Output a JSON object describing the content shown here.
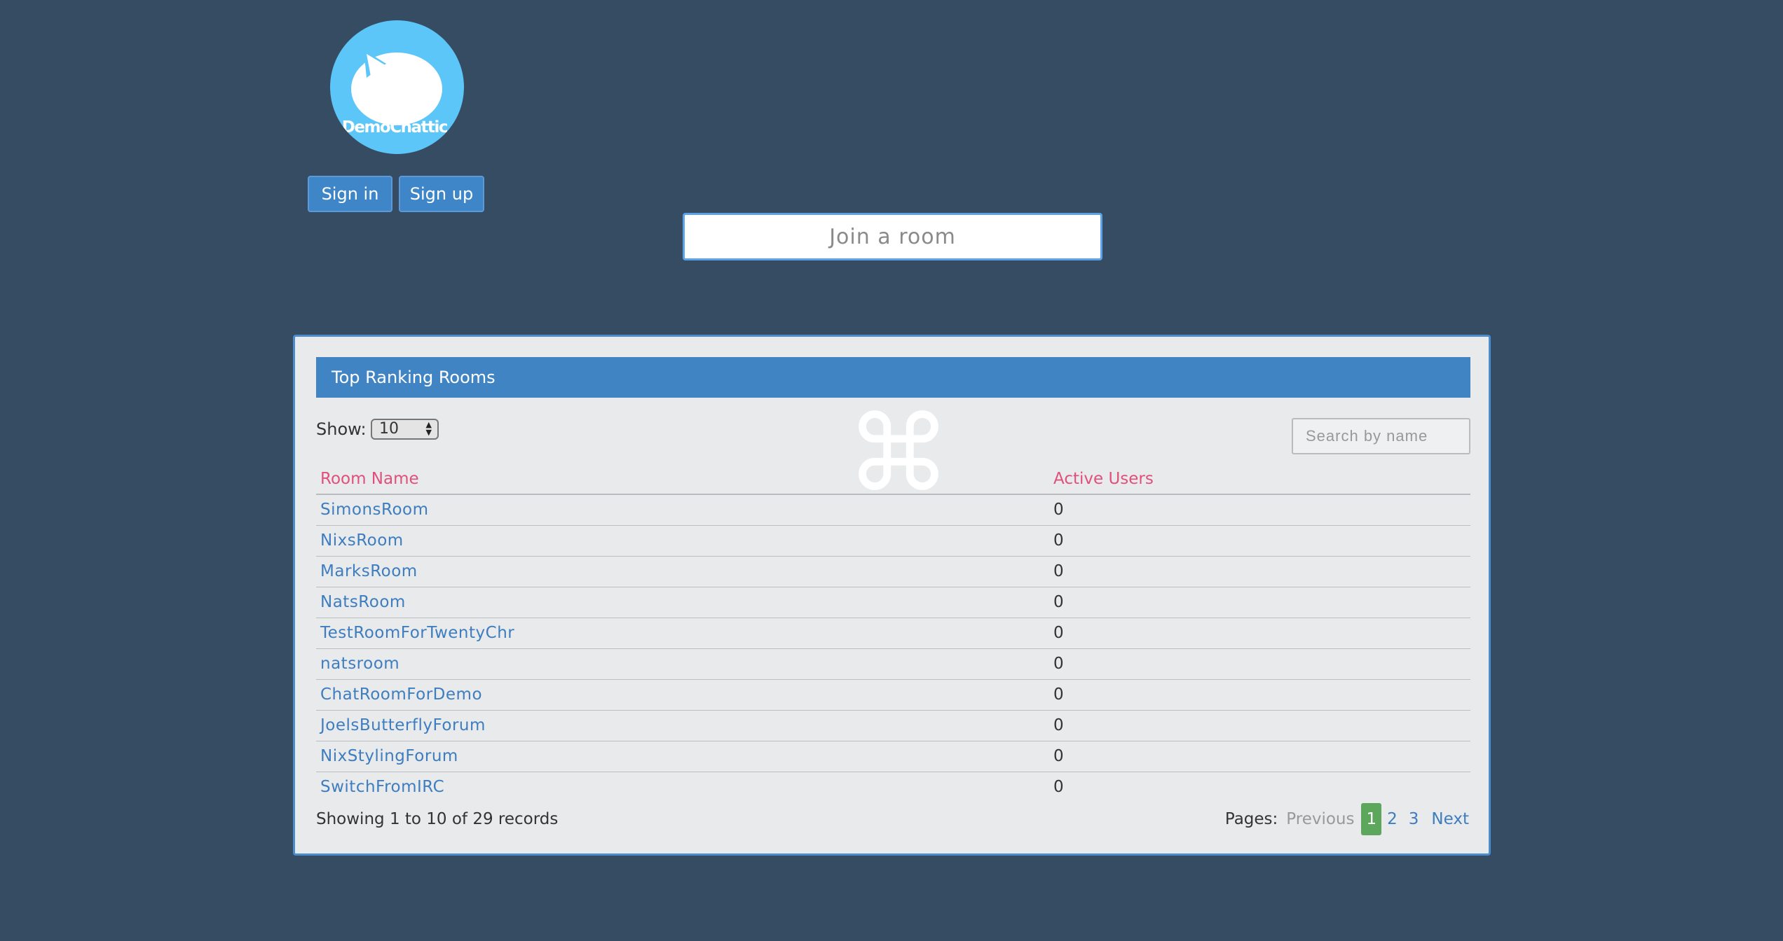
{
  "header": {
    "logo_text": "DemoChattic.",
    "signin_label": "Sign in",
    "signup_label": "Sign up",
    "join_placeholder": "Join a room"
  },
  "panel": {
    "title": "Top Ranking Rooms",
    "show_label": "Show:",
    "show_value": "10",
    "search_placeholder": "Search by name",
    "command_icon": "⌘",
    "columns": [
      "Room Name",
      "Active Users"
    ],
    "rows": [
      {
        "name": "SimonsRoom",
        "users": "0"
      },
      {
        "name": "NixsRoom",
        "users": "0"
      },
      {
        "name": "MarksRoom",
        "users": "0"
      },
      {
        "name": "NatsRoom",
        "users": "0"
      },
      {
        "name": "TestRoomForTwentyChr",
        "users": "0"
      },
      {
        "name": "natsroom",
        "users": "0"
      },
      {
        "name": "ChatRoomForDemo",
        "users": "0"
      },
      {
        "name": "JoelsButterflyForum",
        "users": "0"
      },
      {
        "name": "NixStylingForum",
        "users": "0"
      },
      {
        "name": "SwitchFromIRC",
        "users": "0"
      }
    ],
    "records_info": "Showing 1 to 10 of 29 records",
    "pagination": {
      "label": "Pages:",
      "previous": "Previous",
      "pages": [
        "1",
        "2",
        "3"
      ],
      "active_page": "1",
      "next": "Next"
    }
  },
  "colors": {
    "background": "#364c63",
    "accent": "#4084c3",
    "header_text": "#e0507a",
    "link": "#3e7dbf",
    "active_page": "#5ca75c",
    "logo": "#5cc6f8"
  }
}
